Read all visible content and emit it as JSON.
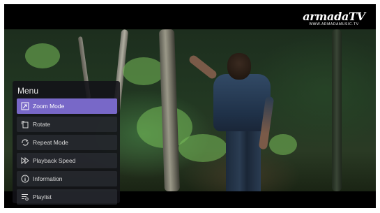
{
  "logo": {
    "main": "armadaTV",
    "sub": "WWW.ARMADAMUSIC.TV"
  },
  "menu": {
    "title": "Menu",
    "items": [
      {
        "label": "Zoom Mode",
        "icon": "zoom-icon",
        "selected": true
      },
      {
        "label": "Rotate",
        "icon": "rotate-icon",
        "selected": false
      },
      {
        "label": "Repeat Mode",
        "icon": "repeat-icon",
        "selected": false
      },
      {
        "label": "Playback Speed",
        "icon": "fast-forward-icon",
        "selected": false
      },
      {
        "label": "Information",
        "icon": "info-icon",
        "selected": false
      },
      {
        "label": "Playlist",
        "icon": "playlist-icon",
        "selected": false
      }
    ]
  },
  "colors": {
    "selected_item": "#7868c8",
    "menu_bg": "#121218"
  }
}
